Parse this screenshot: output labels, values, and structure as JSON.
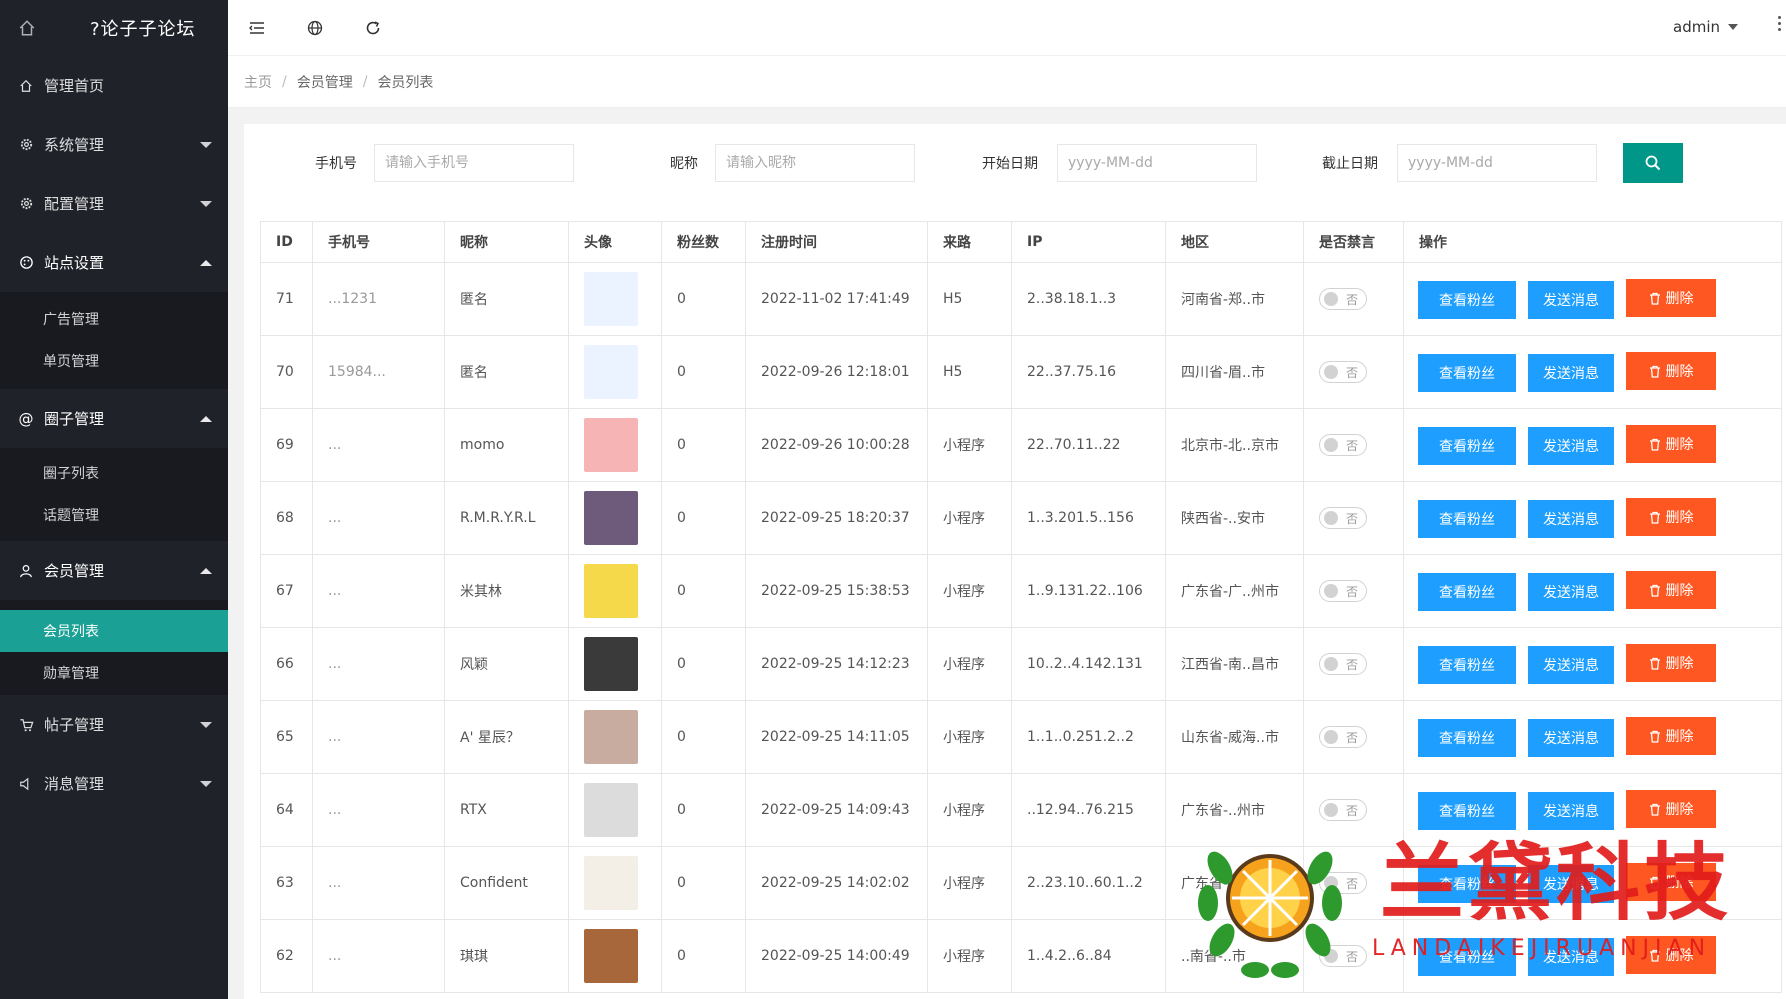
{
  "sidebar": {
    "logo_text": "?论子子论坛",
    "menu": [
      {
        "label": "管理首页",
        "icon": "home-icon"
      },
      {
        "label": "系统管理",
        "icon": "gear-icon"
      },
      {
        "label": "配置管理",
        "icon": "cog-icon"
      },
      {
        "label": "站点设置",
        "icon": "palette-icon",
        "sub": [
          "广告管理",
          "单页管理"
        ]
      },
      {
        "label": "圈子管理",
        "icon": "at-icon",
        "sub": [
          "圈子列表",
          "话题管理"
        ]
      },
      {
        "label": "会员管理",
        "icon": "user-icon",
        "sub": [
          "会员列表",
          "勋章管理"
        ]
      },
      {
        "label": "帖子管理",
        "icon": "cart-icon"
      },
      {
        "label": "消息管理",
        "icon": "speaker-icon"
      }
    ]
  },
  "header": {
    "user": "admin"
  },
  "breadcrumb": [
    "主页",
    "会员管理",
    "会员列表"
  ],
  "search": {
    "phone_label": "手机号",
    "phone_placeholder": "请输入手机号",
    "nick_label": "昵称",
    "nick_placeholder": "请输入昵称",
    "start_label": "开始日期",
    "start_placeholder": "yyyy-MM-dd",
    "end_label": "截止日期",
    "end_placeholder": "yyyy-MM-dd"
  },
  "table": {
    "columns": [
      "ID",
      "手机号",
      "昵称",
      "头像",
      "粉丝数",
      "注册时间",
      "来路",
      "IP",
      "地区",
      "是否禁言",
      "操作"
    ],
    "rows": [
      {
        "id": "71",
        "phone": "...1231",
        "nick": "匿名",
        "fans": "0",
        "time": "2022-11-02 17:41:49",
        "source": "H5",
        "ip": "2..38.18.1..3",
        "region": "河南省-郑..市",
        "mute": "否",
        "avatar_color": "#eaf3ff"
      },
      {
        "id": "70",
        "phone": "15984...",
        "nick": "匿名",
        "fans": "0",
        "time": "2022-09-26 12:18:01",
        "source": "H5",
        "ip": "22..37.75.16",
        "region": "四川省-眉..市",
        "mute": "否",
        "avatar_color": "#eaf3ff"
      },
      {
        "id": "69",
        "phone": "...",
        "nick": "momo",
        "fans": "0",
        "time": "2022-09-26 10:00:28",
        "source": "小程序",
        "ip": "22..70.11..22",
        "region": "北京市-北..京市",
        "mute": "否",
        "avatar_color": "#f6b4b4"
      },
      {
        "id": "68",
        "phone": "...",
        "nick": "R.M.R.Y.R.L",
        "fans": "0",
        "time": "2022-09-25 18:20:37",
        "source": "小程序",
        "ip": "1..3.201.5..156",
        "region": "陕西省-..安市",
        "mute": "否",
        "avatar_color": "#6e5a7a"
      },
      {
        "id": "67",
        "phone": "...",
        "nick": "米其林",
        "fans": "0",
        "time": "2022-09-25 15:38:53",
        "source": "小程序",
        "ip": "1..9.131.22..106",
        "region": "广东省-广..州市",
        "mute": "否",
        "avatar_color": "#f5d94a"
      },
      {
        "id": "66",
        "phone": "...",
        "nick": "风颖",
        "fans": "0",
        "time": "2022-09-25 14:12:23",
        "source": "小程序",
        "ip": "10..2..4.142.131",
        "region": "江西省-南..昌市",
        "mute": "否",
        "avatar_color": "#3a3a3a"
      },
      {
        "id": "65",
        "phone": "...",
        "nick": "A' 星辰？",
        "fans": "0",
        "time": "2022-09-25 14:11:05",
        "source": "小程序",
        "ip": "1..1..0.251.2..2",
        "region": "山东省-威海..市",
        "mute": "否",
        "avatar_color": "#c9aca0"
      },
      {
        "id": "64",
        "phone": "...",
        "nick": "RTX",
        "fans": "0",
        "time": "2022-09-25 14:09:43",
        "source": "小程序",
        "ip": "..12.94..76.215",
        "region": "广东省-..州市",
        "mute": "否",
        "avatar_color": "#dcdcdc"
      },
      {
        "id": "63",
        "phone": "...",
        "nick": "Confident",
        "fans": "0",
        "time": "2022-09-25 14:02:02",
        "source": "小程序",
        "ip": "2..23.10..60.1..2",
        "region": "广东省-..市",
        "mute": "否",
        "avatar_color": "#f4efe6"
      },
      {
        "id": "62",
        "phone": "...",
        "nick": "琪琪",
        "fans": "0",
        "time": "2022-09-25 14:00:49",
        "source": "小程序",
        "ip": "1..4.2..6..84",
        "region": "..南省-..市",
        "mute": "否",
        "avatar_color": "#a8673a"
      }
    ],
    "actions": {
      "fans": "查看粉丝",
      "message": "发送消息",
      "delete": "删除"
    }
  },
  "watermark": {
    "title": "兰黛科技",
    "subtitle": "LANDAIKEJIRUANJIAN"
  },
  "colors": {
    "sidebar": "#20222a",
    "accent": "#009688",
    "selected": "#1aa094",
    "blue": "#1e9fff",
    "red": "#ff5722"
  }
}
